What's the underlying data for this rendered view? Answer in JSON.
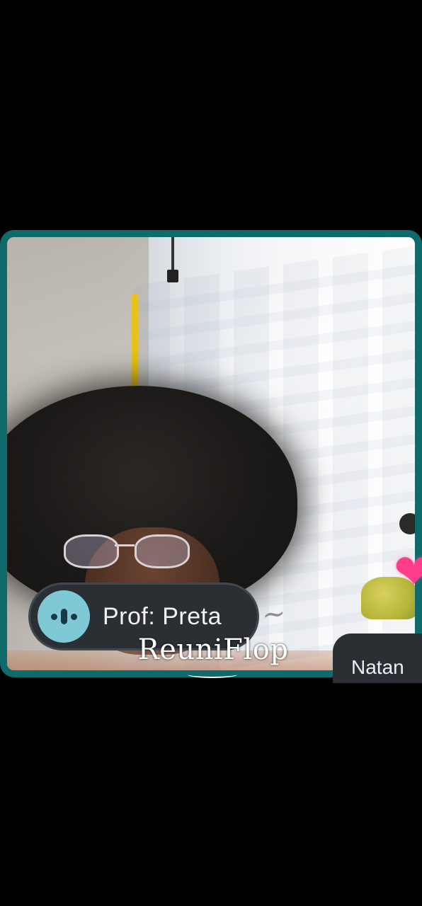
{
  "speaker": {
    "name": "Prof: Preta",
    "mic_icon": "audio-level-icon"
  },
  "participant": {
    "name": "Natan"
  },
  "reaction": {
    "icon": "heart-icon",
    "glyph": "❤",
    "color": "#ff3d8a"
  },
  "watermark": {
    "text": "ReuniFlop"
  },
  "colors": {
    "tile_border": "#0f6b6b",
    "mic_indicator": "#7fc8d6",
    "pill_background": "#2a2f33"
  }
}
